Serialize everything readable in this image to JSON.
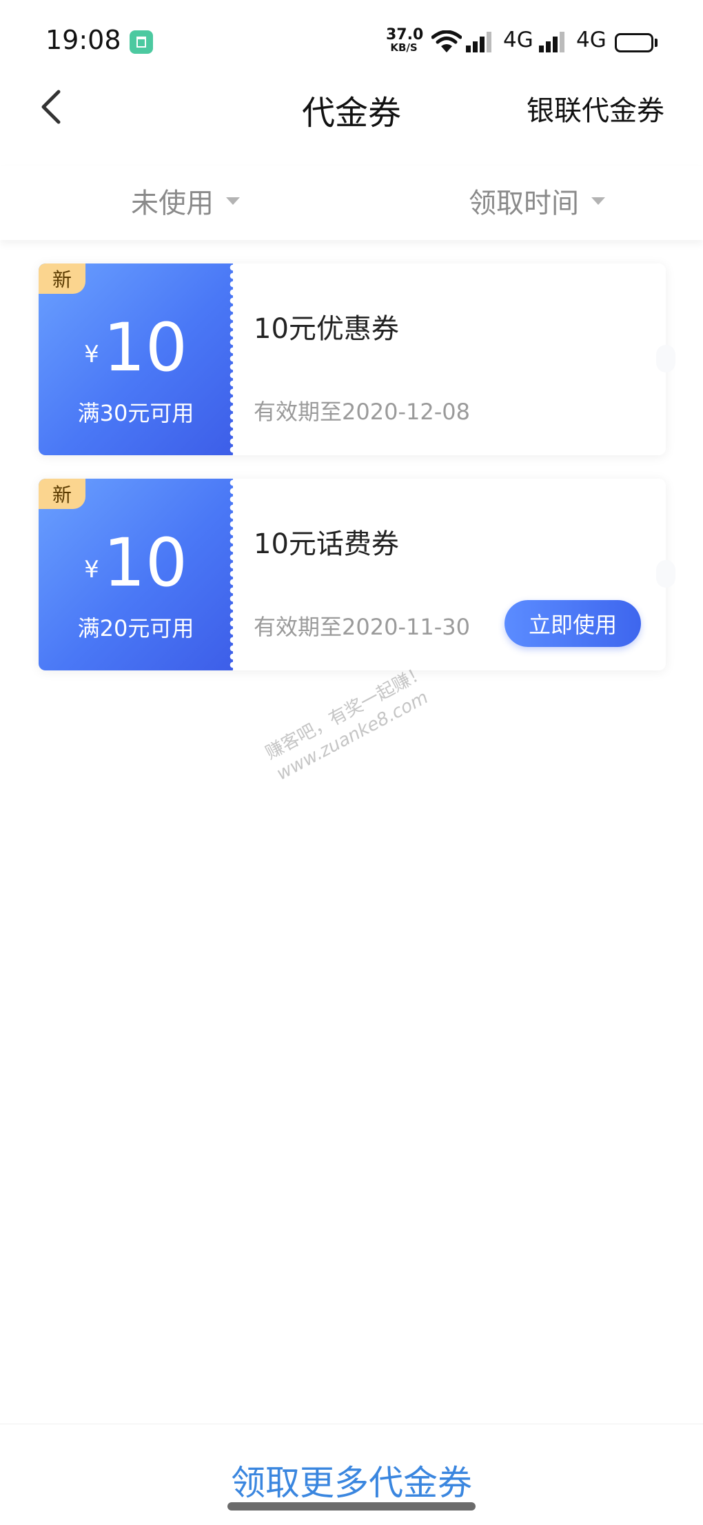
{
  "status_bar": {
    "time": "19:08",
    "speed_value": "37.0",
    "speed_unit": "KB/S",
    "network_1": "4G",
    "network_2": "4G",
    "icons": [
      "app-badge-icon",
      "wifi-icon",
      "signal-icon",
      "signal-icon",
      "battery-icon"
    ]
  },
  "header": {
    "back_icon": "chevron-left-icon",
    "title": "代金券",
    "right_link": "银联代金券"
  },
  "filters": {
    "status_label": "未使用",
    "sort_label": "领取时间",
    "caret_icon": "triangle-down-icon"
  },
  "coupons": [
    {
      "tag": "新",
      "currency": "¥",
      "amount": "10",
      "condition": "满30元可用",
      "title": "10元优惠券",
      "validity": "有效期至2020-12-08",
      "action": ""
    },
    {
      "tag": "新",
      "currency": "¥",
      "amount": "10",
      "condition": "满20元可用",
      "title": "10元话费券",
      "validity": "有效期至2020-11-30",
      "action": "立即使用"
    }
  ],
  "watermark": {
    "line1": "赚客吧，有奖一起赚！",
    "line2": "www.zuanke8.com"
  },
  "footer": {
    "more_link": "领取更多代金券"
  },
  "colors": {
    "accent": "#3e66ee",
    "link": "#3a86df",
    "tag": "#fbd58f",
    "muted": "#9a9a9a"
  }
}
